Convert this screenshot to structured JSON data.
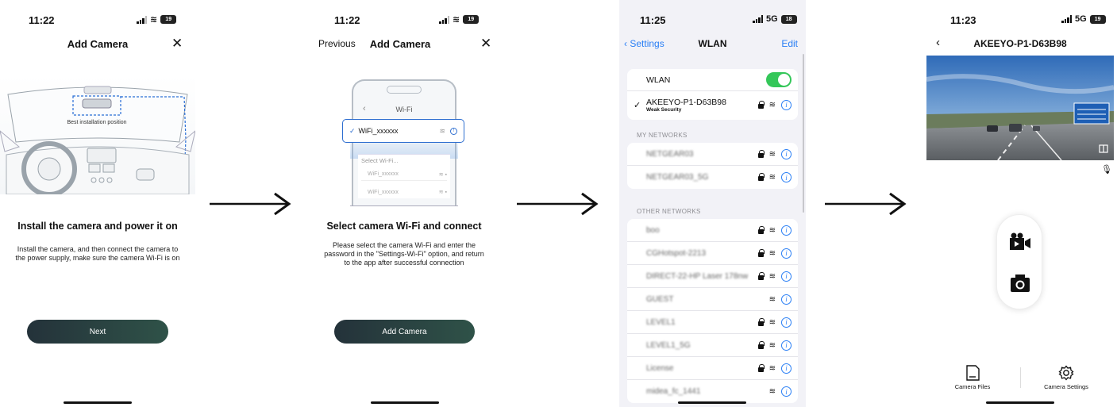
{
  "screen1": {
    "time": "11:22",
    "battery": "19",
    "title": "Add Camera",
    "close": "✕",
    "diagram_label": "Best installation position",
    "heading": "Install the camera and power it on",
    "desc_line1": "Install the camera, and then connect the camera to",
    "desc_line2": "the power supply, make sure the camera Wi-Fi is on",
    "button": "Next"
  },
  "screen2": {
    "time": "11:22",
    "battery": "19",
    "prev": "Previous",
    "title": "Add Camera",
    "close": "✕",
    "mock_header": "Wi-Fi",
    "mock_selected": "WiFi_xxxxxx",
    "mock_section": "Select Wi-Fi...",
    "mock_items": [
      "WiFi_xxxxxx",
      "WiFi_xxxxxx"
    ],
    "heading": "Select camera Wi-Fi and connect",
    "desc_line1": "Please select the camera Wi-Fi and enter the",
    "desc_line2": "password in the \"Settings-Wi-Fi\" option, and return",
    "desc_line3": "to the app after successful connection",
    "button": "Add Camera"
  },
  "screen3": {
    "time": "11:25",
    "net": "5G",
    "battery": "18",
    "back": "Settings",
    "title": "WLAN",
    "edit": "Edit",
    "wlan_label": "WLAN",
    "connected_name": "AKEEYO-P1-D63B98",
    "connected_sub": "Weak Security",
    "my_networks_label": "MY NETWORKS",
    "my_networks": [
      "NETGEAR03",
      "NETGEAR03_5G"
    ],
    "other_networks_label": "OTHER NETWORKS",
    "other_networks": [
      "boo",
      "CGHotspot-2213",
      "DIRECT-22-HP Laser 178nw",
      "GUEST",
      "LEVEL1",
      "LEVEL1_5G",
      "License",
      "midea_fc_1441"
    ]
  },
  "screen4": {
    "time": "11:23",
    "net": "5G",
    "battery": "19",
    "title": "AKEEYO-P1-D63B98",
    "tab_files": "Camera Files",
    "tab_settings": "Camera Settings"
  },
  "colors": {
    "accent": "#2a7ff5",
    "toggle": "#34c759",
    "button": "#2a403f"
  }
}
